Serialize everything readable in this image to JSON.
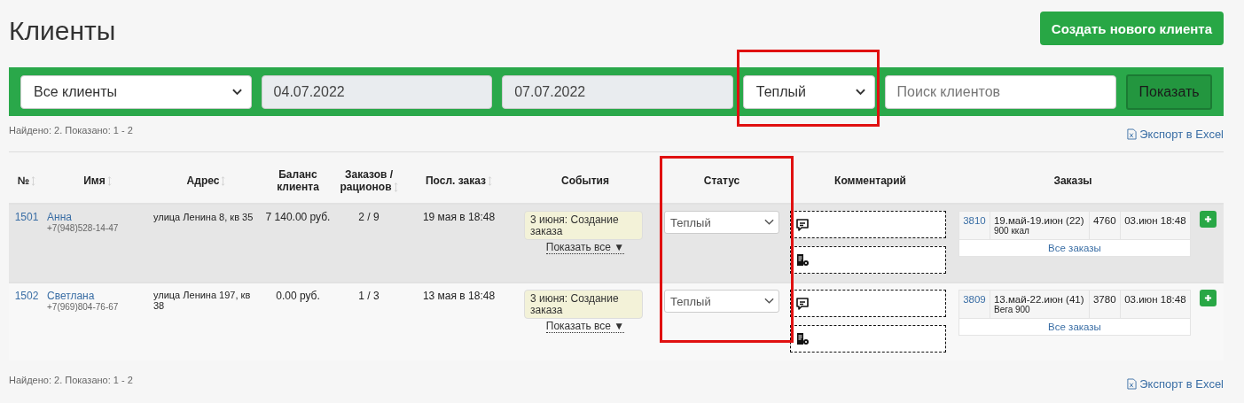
{
  "page": {
    "title": "Клиенты",
    "create_button": "Создать нового клиента"
  },
  "filters": {
    "client_type": "Все клиенты",
    "date_from": "04.07.2022",
    "date_to": "07.07.2022",
    "status": "Теплый",
    "search": {
      "placeholder": "Поиск клиентов"
    },
    "show_button": "Показать"
  },
  "summary_top": "Найдено: 2. Показано: 1 - 2",
  "export_top": "Экспорт в Excel",
  "table": {
    "columns": [
      {
        "label": "№",
        "sortable": true
      },
      {
        "label": "Имя",
        "sortable": true
      },
      {
        "label": "Адрес",
        "sortable": true
      },
      {
        "label": "Баланс клиента",
        "sortable": false
      },
      {
        "label": "Заказов / рационов",
        "sortable": true
      },
      {
        "label": "Посл. заказ",
        "sortable": true
      },
      {
        "label": "События",
        "sortable": false
      },
      {
        "label": "Статус",
        "sortable": false
      },
      {
        "label": "Комментарий",
        "sortable": false
      },
      {
        "label": "Заказы",
        "sortable": false
      }
    ],
    "rows": [
      {
        "highlighted": true,
        "id": "1501",
        "name": "Анна",
        "phone": "+7(948)528-14-47",
        "address": "улица Ленина 8, кв 35",
        "balance": "7 140.00 руб.",
        "orders_rations": "2 / 9",
        "last_order": "19 мая в 18:48",
        "event": "3 июня: Создание заказа",
        "show_all": "Показать все ▼",
        "status": "Теплый",
        "orders": [
          {
            "number": "3810",
            "period": "19.май-19.июн (22)",
            "plan": "900 ккал",
            "sum": "4760",
            "date": "03.июн 18:48"
          }
        ],
        "all_orders": "Все заказы"
      },
      {
        "highlighted": false,
        "id": "1502",
        "name": "Светлана",
        "phone": "+7(969)804-76-67",
        "address": "улица Ленина 197, кв 38",
        "balance": "0.00 руб.",
        "orders_rations": "1 / 3",
        "last_order": "13 мая в 18:48",
        "event": "3 июня: Создание заказа",
        "show_all": "Показать все ▼",
        "status": "Теплый",
        "orders": [
          {
            "number": "3809",
            "period": "13.май-22.июн (41)",
            "plan": "Вега 900",
            "sum": "3780",
            "date": "03.июн 18:48"
          }
        ],
        "all_orders": "Все заказы"
      }
    ]
  },
  "summary_bottom": "Найдено: 2. Показано: 1 - 2",
  "export_bottom": "Экспорт в Excel"
}
